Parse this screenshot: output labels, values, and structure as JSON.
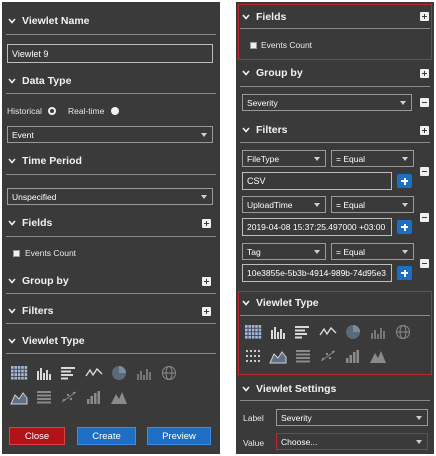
{
  "left": {
    "viewlet_name": {
      "title": "Viewlet Name",
      "value": "Viewlet 9"
    },
    "data_type": {
      "title": "Data Type",
      "historical": "Historical",
      "realtime": "Real-time",
      "selected": "Event"
    },
    "time_period": {
      "title": "Time Period",
      "selected": "Unspecified"
    },
    "fields": {
      "title": "Fields",
      "item": "Events Count"
    },
    "group_by": {
      "title": "Group by"
    },
    "filters": {
      "title": "Filters"
    },
    "viewlet_type": {
      "title": "Viewlet Type"
    },
    "buttons": {
      "close": "Close",
      "create": "Create",
      "preview": "Preview"
    }
  },
  "right": {
    "fields": {
      "title": "Fields",
      "item": "Events Count"
    },
    "group_by": {
      "title": "Group by",
      "selected": "Severity"
    },
    "filters": {
      "title": "Filters",
      "rows": [
        {
          "field": "FileType",
          "op": "= Equal",
          "value": "CSV"
        },
        {
          "field": "UploadTime",
          "op": "= Equal",
          "value": "2019-04-08 15:37:25.497000 +03:00"
        },
        {
          "field": "Tag",
          "op": "= Equal",
          "value": "10e3855e-5b3b-4914-989b-74d95e3"
        }
      ]
    },
    "viewlet_type": {
      "title": "Viewlet Type"
    },
    "viewlet_settings": {
      "title": "Viewlet Settings",
      "label_caption": "Label",
      "label_value": "Severity",
      "value_caption": "Value",
      "value_value": "Choose..."
    }
  },
  "colors": {
    "panel": "#3a3a3a",
    "accent_blue": "#1e6fc4",
    "close_red": "#b01218",
    "highlight": "#c0272d"
  },
  "icons_left": [
    "heatmap-icon",
    "bar-chart-icon",
    "horizontal-bar-icon",
    "line-chart-icon",
    "pie-chart-icon",
    "column-icon",
    "globe-icon",
    "area-chart-icon",
    "list-icon",
    "scatter-icon",
    "step-bar-icon",
    "mountain-icon"
  ],
  "icons_right": [
    "heatmap-icon",
    "bar-chart-icon",
    "horizontal-bar-icon",
    "line-chart-icon",
    "pie-chart-icon",
    "column-icon",
    "globe-icon",
    "dot-matrix-icon",
    "area-chart-icon",
    "list-icon",
    "scatter-icon",
    "step-bar-icon",
    "mountain-icon"
  ]
}
